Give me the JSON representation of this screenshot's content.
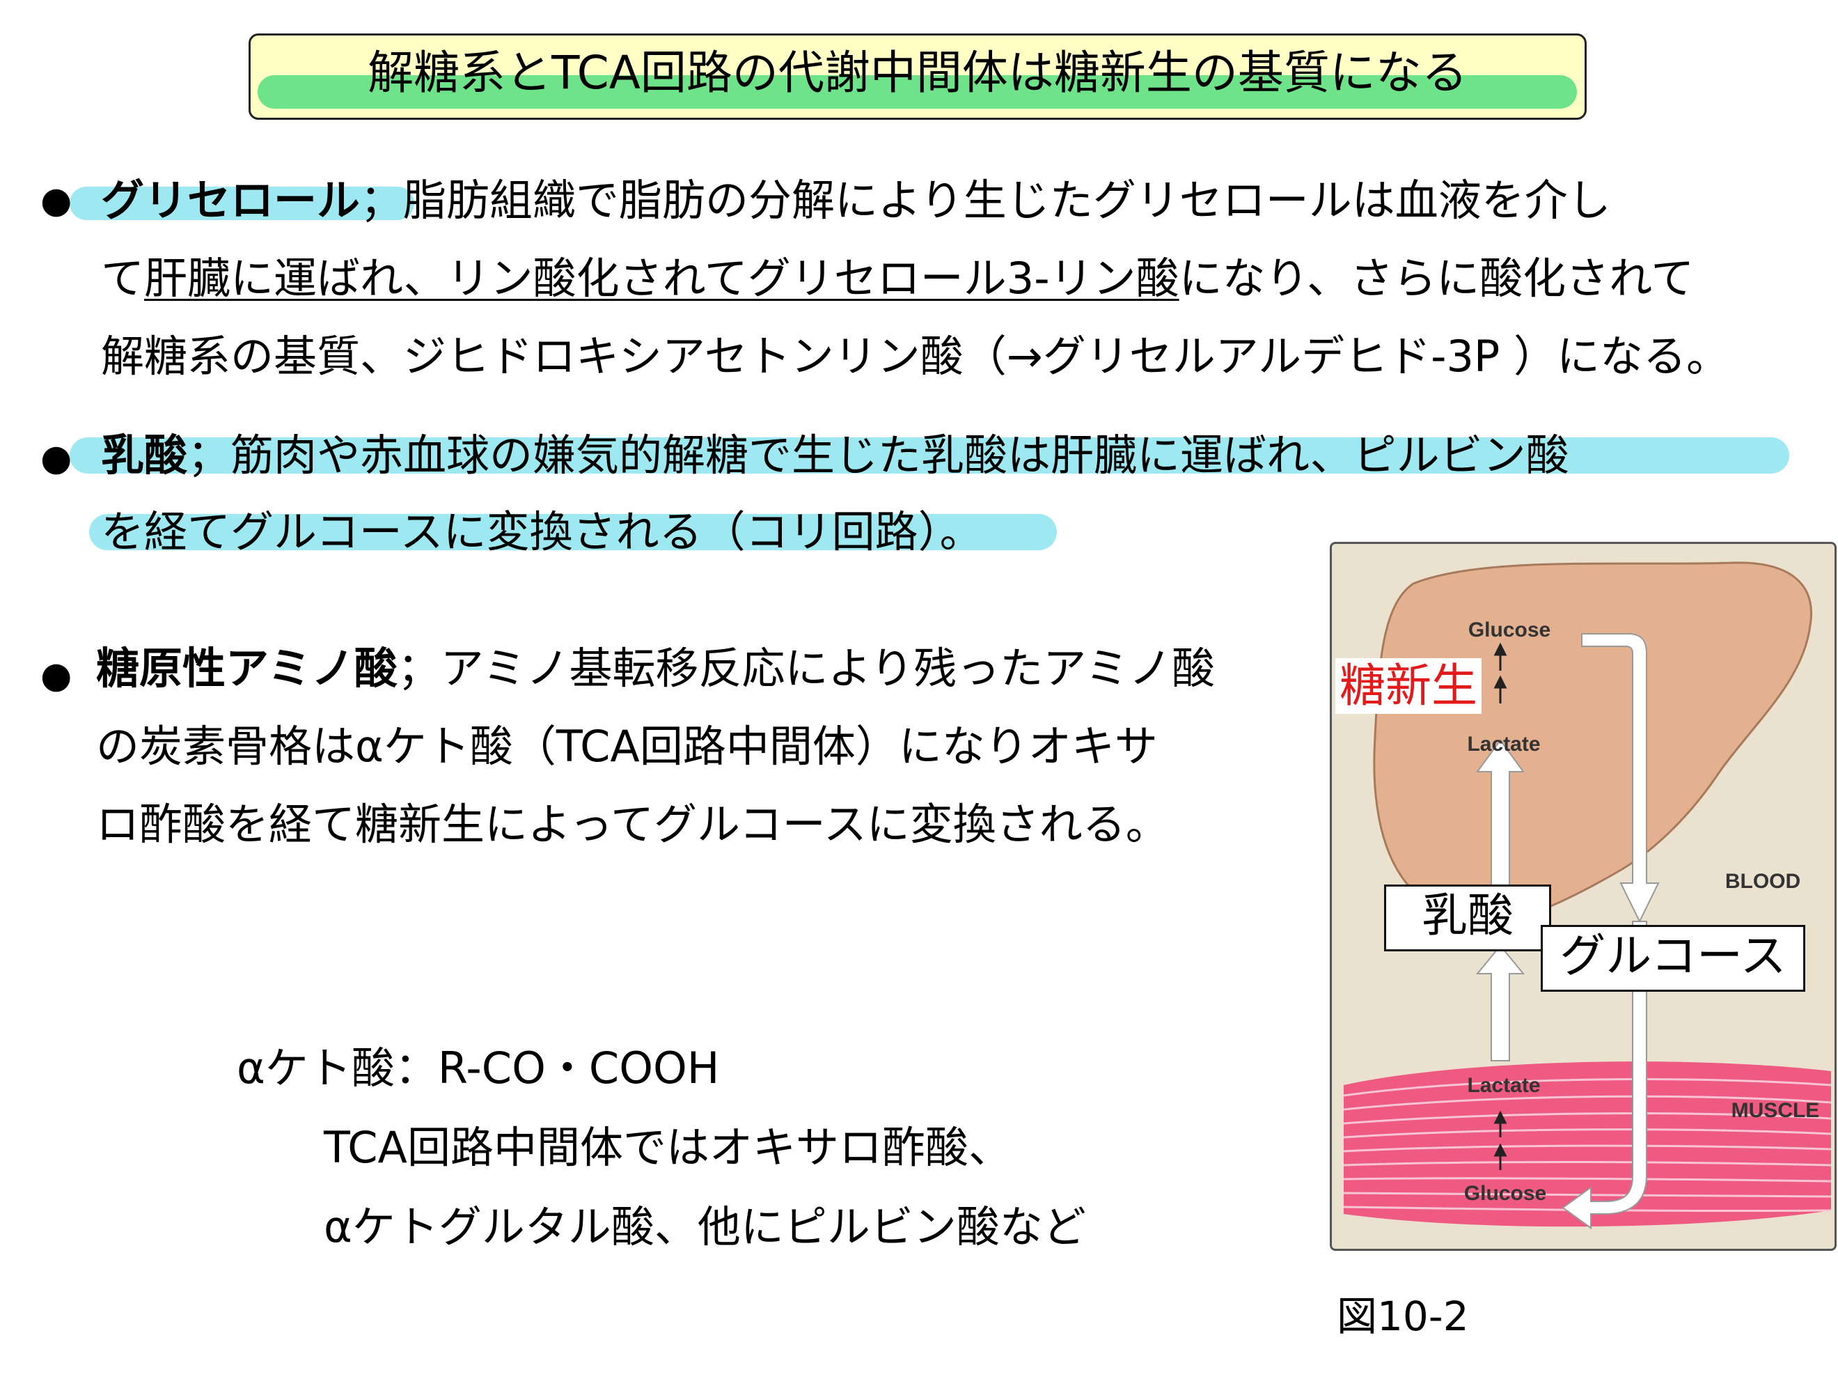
{
  "title": "解糖系とTCA回路の代謝中間体は糖新生の基質になる",
  "bullets": {
    "glycerol": {
      "term": "グリセロール",
      "sep": "；",
      "line1": "脂肪組織で脂肪の分解により生じたグリセロールは血液を介し",
      "line2_pre": "て",
      "line2_underlined": "肝臓に運ばれ、リン酸化されてグリセロール3-リン酸",
      "line2_post": "になり、さらに酸化されて",
      "line3": "解糖系の基質、ジヒドロキシアセトンリン酸（→グリセルアルデヒド-3P ）になる。"
    },
    "lactate": {
      "term": "乳酸",
      "sep": "；",
      "line1": "筋肉や赤血球の嫌気的解糖で生じた乳酸は肝臓に運ばれ、ピルビン酸",
      "line2": "を経てグルコースに変換される（コリ回路）。"
    },
    "amino": {
      "term": "糖原性アミノ酸",
      "sep": "；",
      "line1": "アミノ基転移反応により残ったアミノ酸",
      "line2": "の炭素骨格はαケト酸（TCA回路中間体）になりオキサ",
      "line3": "ロ酢酸を経て糖新生によってグルコースに変換される。"
    },
    "marker": "●"
  },
  "note": {
    "line1": "αケト酸：R-CO・COOH",
    "line2": "TCA回路中間体ではオキサロ酢酸、",
    "line3": "αケトグルタル酸、他にピルビン酸など"
  },
  "figure": {
    "liver_glucose": "Glucose",
    "liver_lactate": "Lactate",
    "blood": "BLOOD",
    "muscle": "MUSCLE",
    "muscle_lactate": "Lactate",
    "muscle_glucose": "Glucose",
    "gluconeogenesis_label": "糖新生",
    "lactate_box": "乳酸",
    "glucose_box": "グルコース",
    "caption": "図10-2",
    "colors": {
      "liver": "#e3b090",
      "muscle": "#ee5a82",
      "background": "#eae1cf",
      "gluconeogenesis_text": "#e21a1a"
    }
  },
  "colors": {
    "title_bg": "#ffffc6",
    "title_highlight": "#6ee389",
    "text_highlight": "#9ee9f1"
  }
}
